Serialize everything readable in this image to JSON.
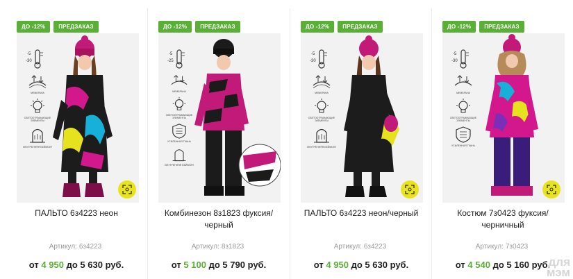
{
  "products": [
    {
      "badge_discount": "ДО -12%",
      "badge_preorder": "ПРЕДЗАКАЗ",
      "title": "ПАЛЬТО 6з4223 неон",
      "sku_label": "Артикул:",
      "sku": "6з4223",
      "price_from": "от",
      "price_min": "4 950",
      "price_to": "до",
      "price_max": "5 630",
      "currency": "руб.",
      "temp_top": "-5",
      "temp_bottom": "-30",
      "feature_labels": [
        "МЕМБРАНА",
        "СВЕТООТРАЖАЮЩИЕ ЭЛЕМЕНТЫ",
        "ВНУТРЕННЯЯ БЕЙКЕЛЯ"
      ]
    },
    {
      "badge_discount": "ДО -12%",
      "badge_preorder": "ПРЕДЗАКАЗ",
      "title": "Комбинезон 8з1823 фуксия/черный",
      "sku_label": "Артикул:",
      "sku": "8з1823",
      "price_from": "от",
      "price_min": "5 100",
      "price_to": "до",
      "price_max": "5 790",
      "currency": "руб.",
      "temp_top": "-5",
      "temp_bottom": "-25",
      "feature_labels": [
        "МЕМБРАНА",
        "СВЕТООТРАЖАЮЩИЕ ЭЛЕМЕНТЫ",
        "УСИЛЕННАЯ ТКАНЬ",
        "ВНУТРЕННЯЯ БЕЙКЕЛЯ"
      ]
    },
    {
      "badge_discount": "ДО -12%",
      "badge_preorder": "ПРЕДЗАКАЗ",
      "title": "ПАЛЬТО 6з4223 неон/черный",
      "sku_label": "Артикул:",
      "sku": "6з4223",
      "price_from": "от",
      "price_min": "4 950",
      "price_to": "до",
      "price_max": "5 630",
      "currency": "руб.",
      "temp_top": "-5",
      "temp_bottom": "-30",
      "feature_labels": [
        "МЕМБРАНА",
        "СВЕТООТРАЖАЮЩИЕ ЭЛЕМЕНТЫ",
        "ВНУТРЕННЯЯ БЕЙКЕЛЯ"
      ]
    },
    {
      "badge_discount": "ДО -12%",
      "badge_preorder": "ПРЕДЗАКАЗ",
      "title": "Костюм 7з0423 фуксия/черничный",
      "sku_label": "Артикул:",
      "sku": "7з0423",
      "price_from": "от",
      "price_min": "4 540",
      "price_to": "до",
      "price_max": "5 160",
      "currency": "руб.",
      "temp_top": "-5",
      "temp_bottom": "-30",
      "feature_labels": [
        "МЕМБРАНА",
        "СВЕТООТРАЖАЮЩИЕ ЭЛЕМЕНТЫ",
        "УСИЛЕННАЯ ТКАНЬ"
      ]
    }
  ],
  "watermark": {
    "line1": "для",
    "line2": "мэм"
  },
  "colors": {
    "accent_green": "#5aaf36",
    "zoom_yellow": "#e8e31a",
    "fuchsia": "#d2188c",
    "dark": "#1e1e1e"
  },
  "icons": [
    "thermometer-icon",
    "membrane-icon",
    "lightbulb-icon",
    "shield-icon",
    "hood-icon",
    "expand-icon"
  ]
}
